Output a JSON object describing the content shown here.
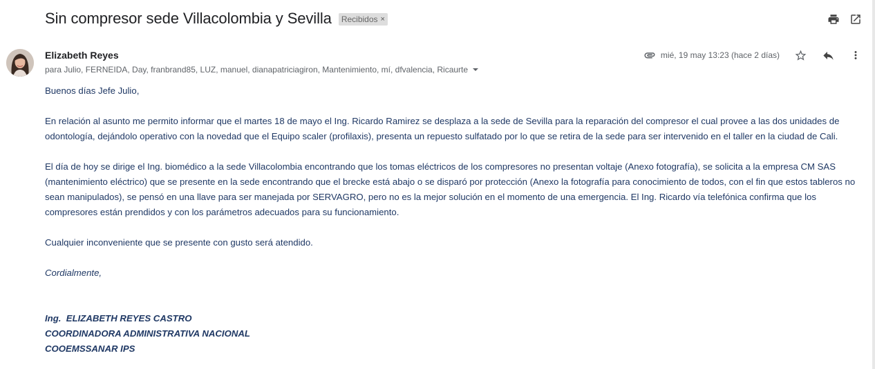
{
  "email": {
    "subject": "Sin compresor sede Villacolombia y Sevilla",
    "label": "Recibidos",
    "label_close": "×",
    "icons": {
      "print": "print-icon",
      "open_new_window": "open-in-new-icon",
      "attachment": "paperclip-icon",
      "star": "star-icon",
      "reply": "reply-icon",
      "more": "more-vert-icon"
    },
    "sender": {
      "name": "Elizabeth Reyes",
      "recipients": "para Julio, FERNEIDA, Day, franbrand85, LUZ, manuel, dianapatriciagiron, Mantenimiento, mí, dfvalencia, Ricaurte"
    },
    "date": "mié, 19 may 13:23 (hace 2 días)",
    "body": {
      "greeting": "Buenos días Jefe Julio,",
      "paragraph1": "En relación al asunto me permito informar que el martes 18 de mayo el Ing. Ricardo Ramirez se desplaza a la sede de Sevilla para la reparación del compresor el cual provee a las dos unidades de odontología, dejándolo operativo con la novedad que el Equipo scaler (profilaxis), presenta un repuesto sulfatado por lo que se retira de la sede para ser intervenido en el taller en la ciudad de Cali.",
      "paragraph2": "El día de hoy se dirige el Ing. biomédico a la sede Villacolombia encontrando que los tomas eléctricos de los compresores no presentan voltaje (Anexo fotografía), se solicita a la empresa CM SAS (mantenimiento eléctrico) que se presente en la sede encontrando que el brecke está abajo o se disparó por protección (Anexo la fotografía para conocimiento de todos, con el fin que estos tableros no sean manipulados), se pensó en una llave para ser manejada por SERVAGRO, pero no es la mejor solución en el momento de una emergencia. El Ing. Ricardo vía telefónica confirma que los compresores están prendidos y con los parámetros adecuados para su funcionamiento.",
      "paragraph3": "Cualquier inconveniente que se presente con gusto será atendido.",
      "closing": "Cordialmente,",
      "signature": {
        "name": "Ing.  ELIZABETH REYES CASTRO",
        "title": "COORDINADORA ADMINISTRATIVA NACIONAL",
        "company": "COOEMSSANAR IPS"
      }
    }
  },
  "colors": {
    "body_text": "#1f3864",
    "subject": "#202124",
    "meta": "#5f6368",
    "label_bg": "#dddddd"
  }
}
